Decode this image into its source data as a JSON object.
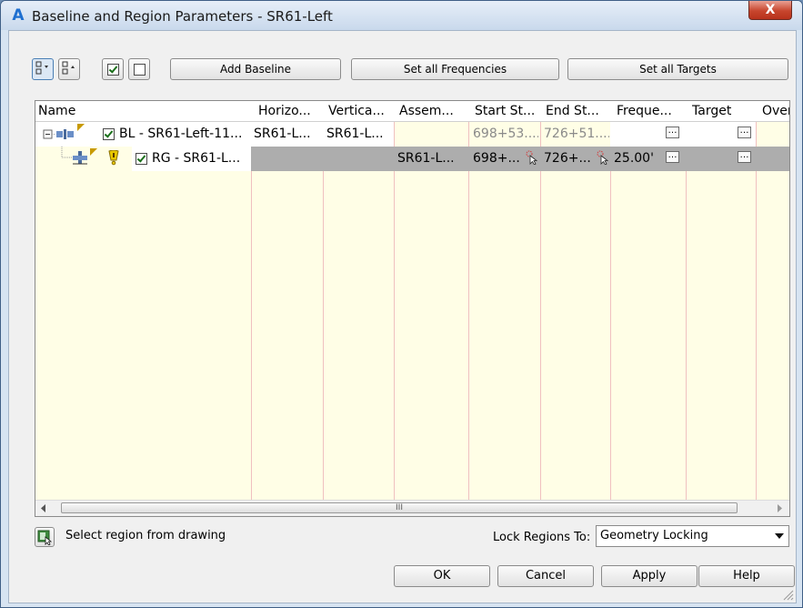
{
  "window": {
    "title": "Baseline and Region Parameters - SR61-Left",
    "app_icon": "autocad-a-icon",
    "close_label": "X"
  },
  "toolbar": {
    "add_baseline": "Add Baseline",
    "set_all_frequencies": "Set all Frequencies",
    "set_all_targets": "Set all Targets"
  },
  "grid": {
    "columns": [
      "Name",
      "Horizo...",
      "Vertica...",
      "Assem...",
      "Start St...",
      "End St...",
      "Freque...",
      "Target",
      "Over"
    ],
    "rows": [
      {
        "name": "BL - SR61-Left-11...",
        "horizontal": "SR61-L...",
        "vertical": "SR61-L...",
        "assembly": "",
        "start": "698+53....",
        "end": "726+51....",
        "frequency": "",
        "checked": true
      },
      {
        "name": "RG - SR61-L...",
        "horizontal": "",
        "vertical": "",
        "assembly": "SR61-L...",
        "start": "698+...",
        "end": "726+...",
        "frequency": "25.00'",
        "checked": true,
        "selected": true
      }
    ],
    "scroll_grip": "III"
  },
  "footer": {
    "select_region": "Select region from drawing",
    "lock_label": "Lock Regions To:",
    "lock_value": "Geometry Locking",
    "ok": "OK",
    "cancel": "Cancel",
    "apply": "Apply",
    "help": "Help"
  },
  "colors": {
    "grid_background": "#fffee6",
    "selected_row": "#adadad",
    "title_bar": "#c9d9ec"
  }
}
